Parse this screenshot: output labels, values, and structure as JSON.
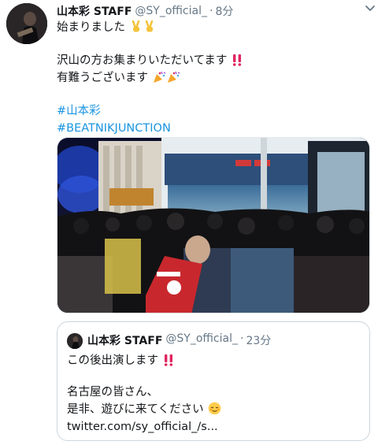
{
  "tweet": {
    "display_name": "山本彩 STAFF",
    "handle": "@SY_official_",
    "separator": "·",
    "time": "8分",
    "lines": {
      "l1": "始まりました",
      "l2": "沢山の方お集まりいただいてます",
      "l3": "有難うございます"
    },
    "hashtags": [
      "#山本彩",
      "#BEATNIKJUNCTION"
    ]
  },
  "quoted_tweet": {
    "display_name": "山本彩 STAFF",
    "handle": "@SY_official_",
    "separator": "·",
    "time": "23分",
    "lines": {
      "l1": "この後出演します",
      "l2": "名古屋の皆さん、",
      "l3": "是非、遊びに来てください",
      "link": "twitter.com/sy_official_/s..."
    }
  },
  "icons": {
    "menu": "chevron-down-icon",
    "victory": "victory-hand-emoji",
    "exclaim": "double-exclamation-emoji",
    "party": "party-popper-emoji",
    "smile": "relieved-face-emoji"
  },
  "colors": {
    "text": "#14171a",
    "secondary": "#657786",
    "link": "#1b95e0",
    "border": "#ccd6dd",
    "exclaim": "#e0245e"
  }
}
